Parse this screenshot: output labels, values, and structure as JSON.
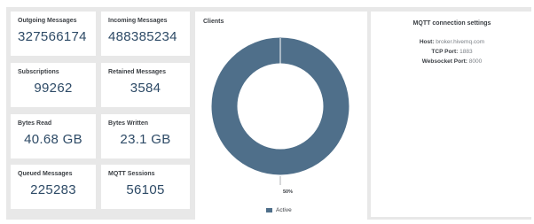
{
  "stats": [
    {
      "label": "Outgoing Messages",
      "value": "327566174"
    },
    {
      "label": "Incoming Messages",
      "value": "488385234"
    },
    {
      "label": "Subscriptions",
      "value": "99262"
    },
    {
      "label": "Retained Messages",
      "value": "3584"
    },
    {
      "label": "Bytes Read",
      "value": "40.68 GB"
    },
    {
      "label": "Bytes Written",
      "value": "23.1 GB"
    },
    {
      "label": "Queued Messages",
      "value": "225283"
    },
    {
      "label": "MQTT Sessions",
      "value": "56105"
    }
  ],
  "clients": {
    "title": "Clients",
    "slice_label": "50%",
    "legend": "Active",
    "color": "#4f6f8a"
  },
  "settings": {
    "title": "MQTT connection settings",
    "host_label": "Host:",
    "host_value": "broker.hivemq.com",
    "tcp_label": "TCP Port:",
    "tcp_value": "1883",
    "ws_label": "Websocket Port:",
    "ws_value": "8000"
  }
}
